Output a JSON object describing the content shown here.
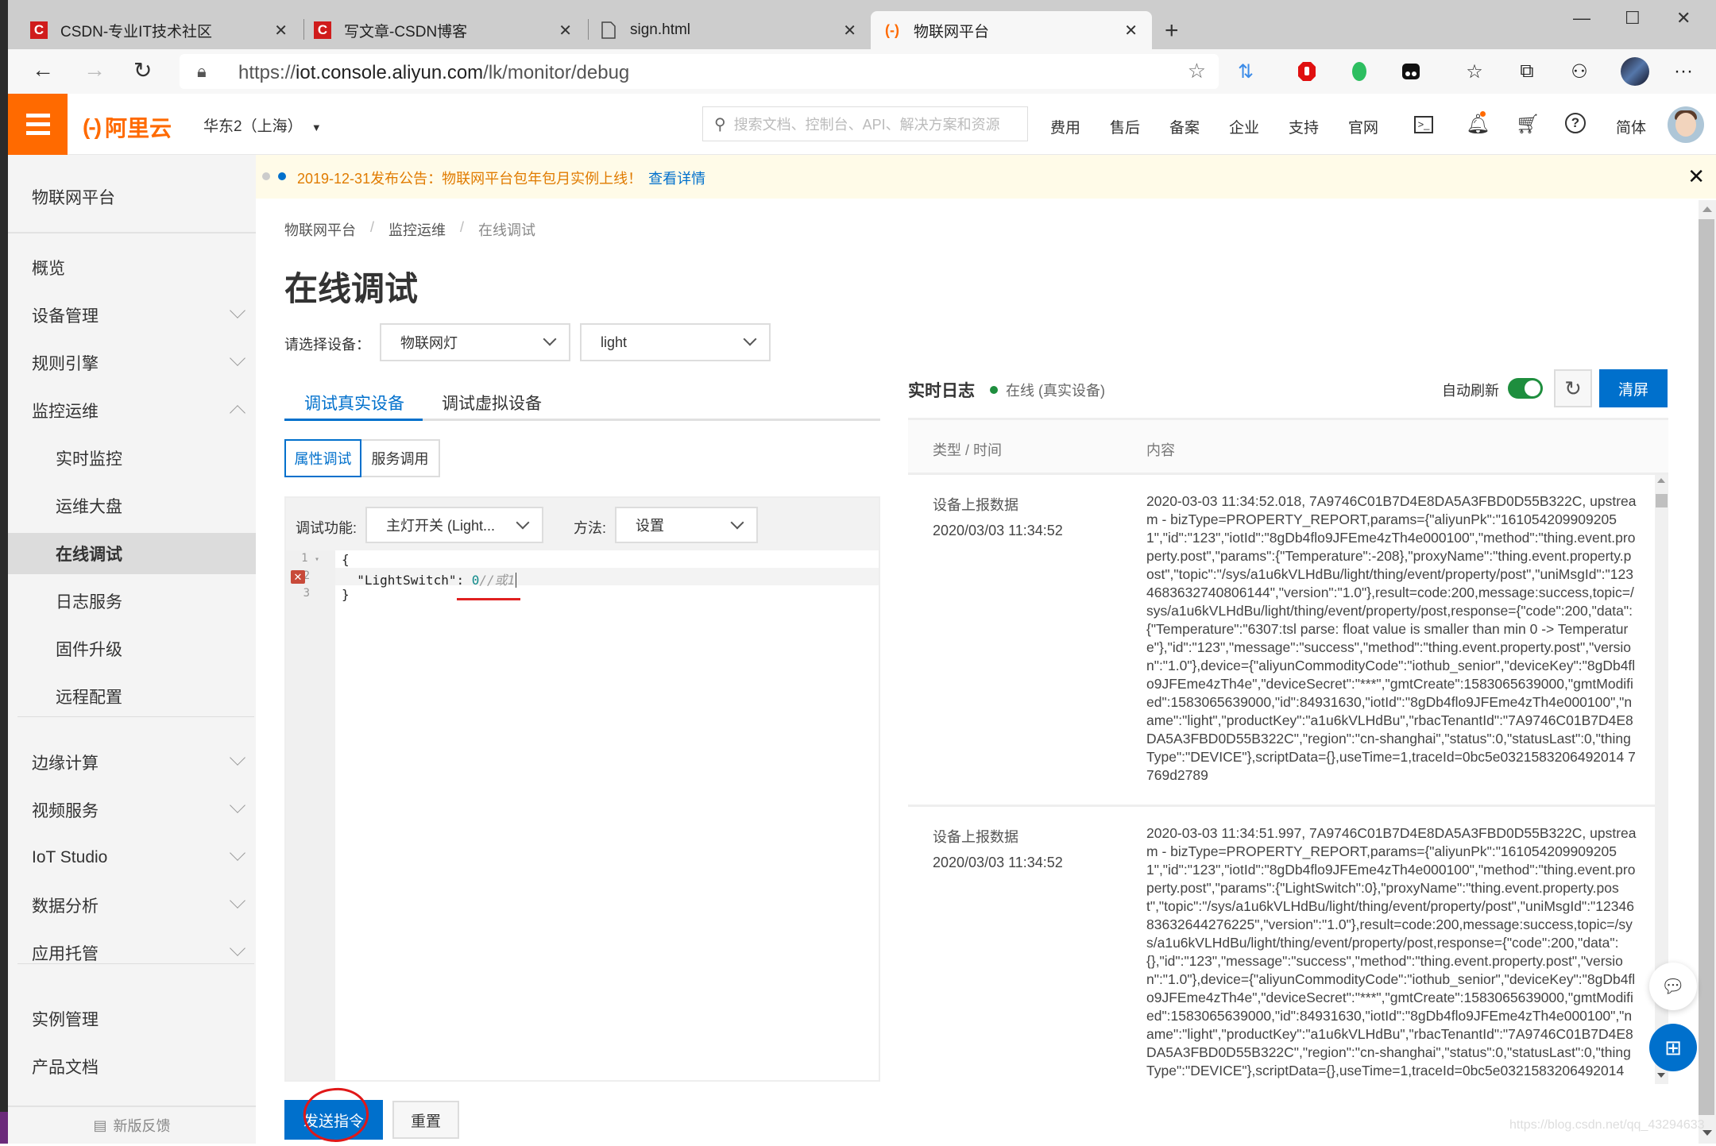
{
  "browser": {
    "tabs": [
      {
        "title": "CSDN-专业IT技术社区",
        "icon": "csdn-icon",
        "active": false
      },
      {
        "title": "写文章-CSDN博客",
        "icon": "csdn-icon",
        "active": false
      },
      {
        "title": "sign.html",
        "icon": "file-icon",
        "active": false
      },
      {
        "title": "物联网平台",
        "icon": "aliyun-icon",
        "active": true
      }
    ],
    "new_tab": "+",
    "url_prefix": "https://",
    "url_host": "iot.console.aliyun.com",
    "url_path": "/lk/monitor/debug",
    "window_controls": {
      "minimize": "—",
      "maximize": "☐",
      "close": "✕"
    }
  },
  "header": {
    "logo_text": "阿里云",
    "region": "华东2（上海）",
    "search_placeholder": "搜索文档、控制台、API、解决方案和资源",
    "nav": [
      "费用",
      "售后",
      "备案",
      "企业",
      "支持",
      "官网"
    ],
    "lang": "简体"
  },
  "notice": {
    "text": "2019-12-31发布公告：物联网平台包年包月实例上线！",
    "link": "查看详情"
  },
  "sidebar": {
    "title": "物联网平台",
    "items": [
      {
        "label": "概览",
        "level": 1,
        "chevron": "none"
      },
      {
        "label": "设备管理",
        "level": 1,
        "chevron": "down"
      },
      {
        "label": "规则引擎",
        "level": 1,
        "chevron": "down"
      },
      {
        "label": "监控运维",
        "level": 1,
        "chevron": "up"
      },
      {
        "label": "实时监控",
        "level": 2
      },
      {
        "label": "运维大盘",
        "level": 2
      },
      {
        "label": "在线调试",
        "level": 2,
        "active": true
      },
      {
        "label": "日志服务",
        "level": 2
      },
      {
        "label": "固件升级",
        "level": 2
      },
      {
        "label": "远程配置",
        "level": 2
      },
      {
        "label": "边缘计算",
        "level": 1,
        "chevron": "down"
      },
      {
        "label": "视频服务",
        "level": 1,
        "chevron": "down"
      },
      {
        "label": "IoT Studio",
        "level": 1,
        "chevron": "down"
      },
      {
        "label": "数据分析",
        "level": 1,
        "chevron": "down"
      },
      {
        "label": "应用托管",
        "level": 1,
        "chevron": "down"
      },
      {
        "label": "实例管理",
        "level": 1,
        "chevron": "none"
      },
      {
        "label": "产品文档",
        "level": 1,
        "chevron": "none"
      }
    ],
    "feedback": "新版反馈"
  },
  "main": {
    "breadcrumb": [
      "物联网平台",
      "监控运维",
      "在线调试"
    ],
    "breadcrumb_sep": "/",
    "title": "在线调试",
    "device_label": "请选择设备：",
    "product_select": "物联网灯",
    "device_select": "light",
    "tabs": [
      {
        "label": "调试真实设备",
        "active": true
      },
      {
        "label": "调试虚拟设备",
        "active": false
      }
    ],
    "subtabs": [
      {
        "label": "属性调试",
        "active": true
      },
      {
        "label": "服务调用",
        "active": false
      }
    ],
    "debug": {
      "func_label": "调试功能:",
      "func_value": "主灯开关 (Light...",
      "method_label": "方法:",
      "method_value": "设置"
    },
    "editor": {
      "lines": [
        {
          "no": "1",
          "fold": "▾",
          "code": "{"
        },
        {
          "no": "2",
          "error": true,
          "key": "  \"LightSwitch\": ",
          "value": "0",
          "comment": "//或1"
        },
        {
          "no": "3",
          "code": "}"
        }
      ]
    },
    "send_button": "发送指令",
    "reset_button": "重置"
  },
  "log": {
    "title": "实时日志",
    "status": "在线 (真实设备)",
    "auto_refresh_label": "自动刷新",
    "auto_refresh_on": true,
    "clear_button": "清屏",
    "columns": [
      "类型 / 时间",
      "内容"
    ],
    "entries": [
      {
        "type": "设备上报数据",
        "time": "2020/03/03 11:34:52",
        "content": "2020-03-03 11:34:52.018, 7A9746C01B7D4E8DA5A3FBD0D55B322C, upstream - bizType=PROPERTY_REPORT,params={\"aliyunPk\":\"1610542099092051\",\"id\":\"123\",\"iotId\":\"8gDb4flo9JFEme4zTh4e000100\",\"method\":\"thing.event.property.post\",\"params\":{\"Temperature\":-208},\"proxyName\":\"thing.event.property.post\",\"topic\":\"/sys/a1u6kVLHdBu/light/thing/event/property/post\",\"uniMsgId\":\"1234683632740806144\",\"version\":\"1.0\"},result=code:200,message:success,topic=/sys/a1u6kVLHdBu/light/thing/event/property/post,response={\"code\":200,\"data\":{\"Temperature\":\"6307:tsl parse: float value is smaller than min 0 -> Temperature\"},\"id\":\"123\",\"message\":\"success\",\"method\":\"thing.event.property.post\",\"version\":\"1.0\"},device={\"aliyunCommodityCode\":\"iothub_senior\",\"deviceKey\":\"8gDb4flo9JFEme4zTh4e\",\"deviceSecret\":\"***\",\"gmtCreate\":1583065639000,\"gmtModified\":1583065639000,\"id\":84931630,\"iotId\":\"8gDb4flo9JFEme4zTh4e000100\",\"name\":\"light\",\"productKey\":\"a1u6kVLHdBu\",\"rbacTenantId\":\"7A9746C01B7D4E8DA5A3FBD0D55B322C\",\"region\":\"cn-shanghai\",\"status\":0,\"statusLast\":0,\"thingType\":\"DEVICE\"},scriptData={},useTime=1,traceId=0bc5e0321583206492014 7769d2789"
      },
      {
        "type": "设备上报数据",
        "time": "2020/03/03 11:34:52",
        "content": "2020-03-03 11:34:51.997, 7A9746C01B7D4E8DA5A3FBD0D55B322C, upstream - bizType=PROPERTY_REPORT,params={\"aliyunPk\":\"1610542099092051\",\"id\":\"123\",\"iotId\":\"8gDb4flo9JFEme4zTh4e000100\",\"method\":\"thing.event.property.post\",\"params\":{\"LightSwitch\":0},\"proxyName\":\"thing.event.property.post\",\"topic\":\"/sys/a1u6kVLHdBu/light/thing/event/property/post\",\"uniMsgId\":\"1234683632644276225\",\"version\":\"1.0\"},result=code:200,message:success,topic=/sys/a1u6kVLHdBu/light/thing/event/property/post,response={\"code\":200,\"data\":{},\"id\":\"123\",\"message\":\"success\",\"method\":\"thing.event.property.post\",\"version\":\"1.0\"},device={\"aliyunCommodityCode\":\"iothub_senior\",\"deviceKey\":\"8gDb4flo9JFEme4zTh4e\",\"deviceSecret\":\"***\",\"gmtCreate\":1583065639000,\"gmtModified\":1583065639000,\"id\":84931630,\"iotId\":\"8gDb4flo9JFEme4zTh4e000100\",\"name\":\"light\",\"productKey\":\"a1u6kVLHdBu\",\"rbacTenantId\":\"7A9746C01B7D4E8DA5A3FBD0D55B322C\",\"region\":\"cn-shanghai\",\"status\":0,\"statusLast\":0,\"thingType\":\"DEVICE\"},scriptData={},useTime=1,traceId=0bc5e0321583206492014"
      }
    ]
  },
  "watermark": "https://blog.csdn.net/qq_43294633",
  "colors": {
    "brand": "#ff6a00",
    "primary": "#0070cc",
    "online": "#1e8e3e",
    "notice_bg": "#fffbe8",
    "notice_text": "#e07b00"
  }
}
